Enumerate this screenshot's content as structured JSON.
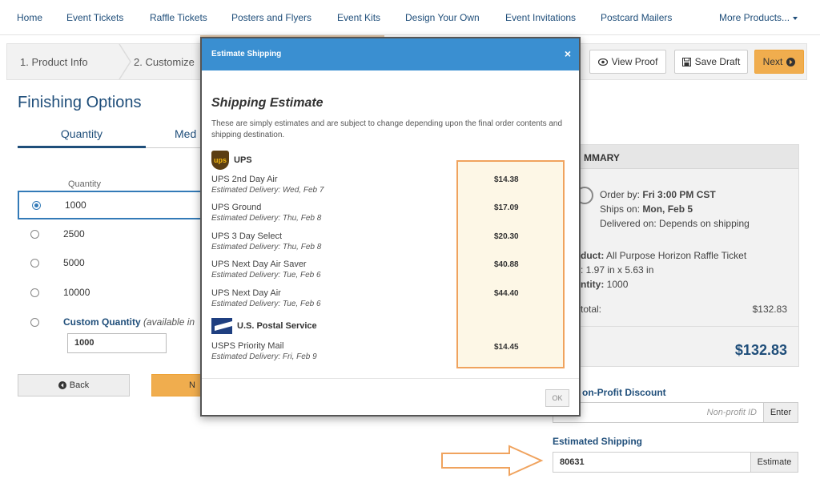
{
  "nav": {
    "items": [
      "Home",
      "Event Tickets",
      "Raffle Tickets",
      "Posters and Flyers",
      "Event Kits",
      "Design Your Own",
      "Event Invitations",
      "Postcard Mailers",
      "More Products..."
    ]
  },
  "steps": {
    "step1": "1. Product Info",
    "step2": "2. Customize",
    "view_proof": "View Proof",
    "save_draft": "Save Draft",
    "next": "Next"
  },
  "left": {
    "heading": "Finishing Options",
    "tab_quantity": "Quantity",
    "tab_media": "Med",
    "col_quantity": "Quantity",
    "rows": [
      "1000",
      "2500",
      "5000",
      "10000"
    ],
    "selected_index": 0,
    "custom_label": "Custom Quantity",
    "custom_note": "(available in",
    "custom_value": "1000",
    "back": "Back",
    "next": "N"
  },
  "summary": {
    "title": "MMARY",
    "order_by_prefix": "Order by:",
    "order_by": "Fri 3:00 PM CST",
    "ships_prefix": "Ships on:",
    "ships_on": "Mon, Feb 5",
    "delivered": "Delivered on: Depends on shipping",
    "product_prefix": "duct:",
    "product": "All Purpose Horizon Raffle Ticket",
    "size": ": 1.97 in x 5.63 in",
    "quantity_prefix": "ntity:",
    "quantity": "1000",
    "subtotal_label": "total:",
    "subtotal": "$132.83",
    "total": "$132.83"
  },
  "discount": {
    "label": "on-Profit Discount",
    "placeholder": "Non-profit ID",
    "button": "Enter"
  },
  "shipping": {
    "label": "Estimated Shipping",
    "zip": "80631",
    "button": "Estimate"
  },
  "modal": {
    "header": "Estimate Shipping",
    "close": "×",
    "title": "Shipping Estimate",
    "description": "These are simply estimates and are subject to change depending upon the final order contents and shipping destination.",
    "ups_name": "UPS",
    "usps_name": "U.S. Postal Service",
    "ups_services": [
      {
        "name": "UPS 2nd Day Air",
        "eta": "Estimated Delivery: Wed, Feb 7",
        "price": "$14.38"
      },
      {
        "name": "UPS Ground",
        "eta": "Estimated Delivery: Thu, Feb 8",
        "price": "$17.09"
      },
      {
        "name": "UPS 3 Day Select",
        "eta": "Estimated Delivery: Thu, Feb 8",
        "price": "$20.30"
      },
      {
        "name": "UPS Next Day Air Saver",
        "eta": "Estimated Delivery: Tue, Feb 6",
        "price": "$40.88"
      },
      {
        "name": "UPS Next Day Air",
        "eta": "Estimated Delivery: Tue, Feb 6",
        "price": "$44.40"
      }
    ],
    "usps_services": [
      {
        "name": "USPS Priority Mail",
        "eta": "Estimated Delivery: Fri, Feb 9",
        "price": "$14.45"
      }
    ],
    "ok": "OK"
  },
  "colors": {
    "nav_text": "#1f4e7a",
    "modal_header": "#3a8fd1",
    "accent_orange": "#f0ad4e",
    "highlight_border": "#f0a35e"
  }
}
